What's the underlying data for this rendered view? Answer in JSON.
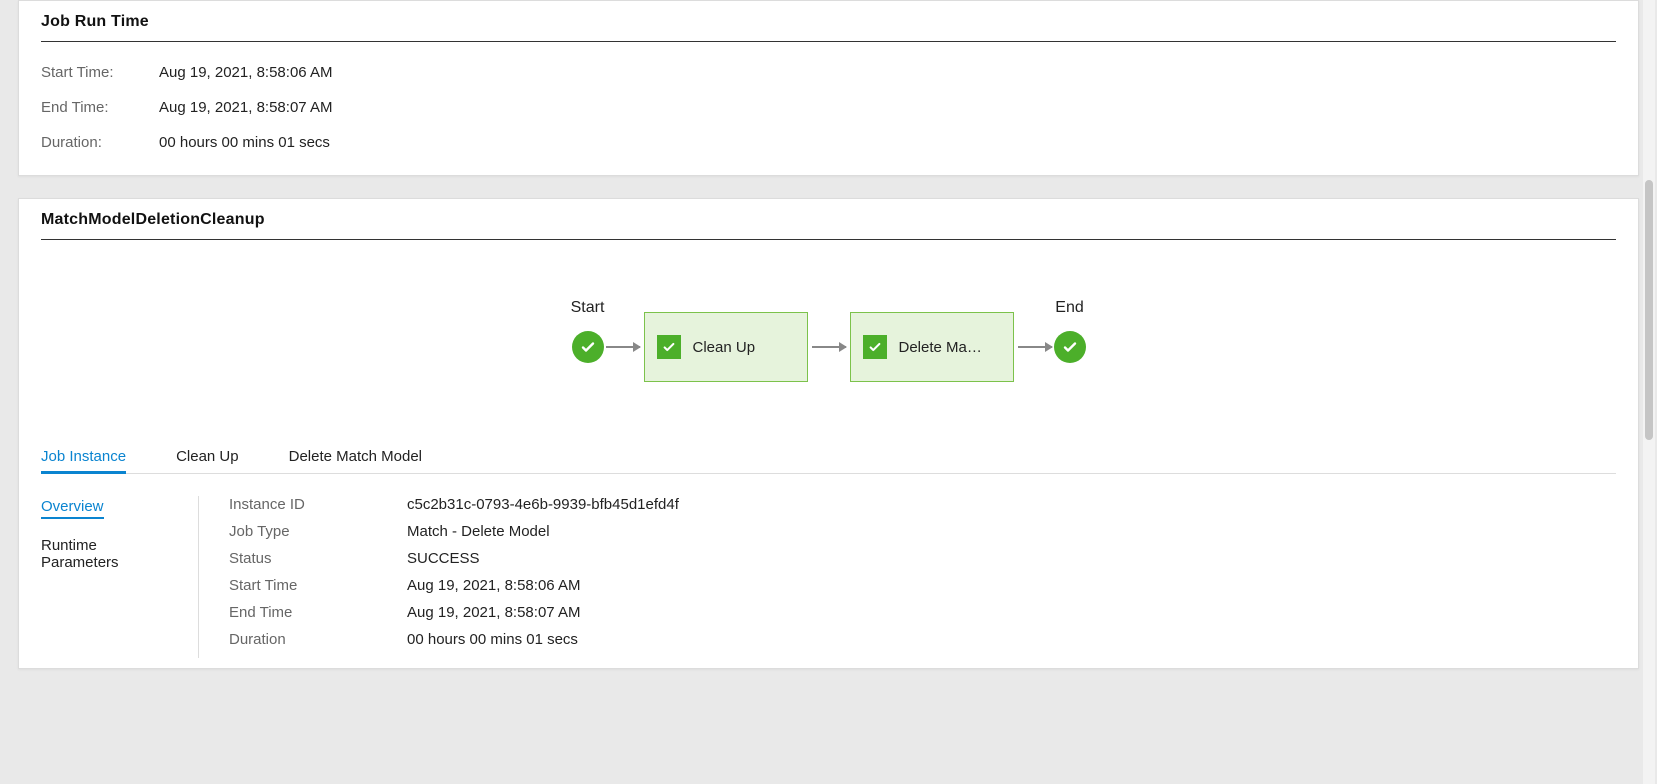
{
  "jobRunTime": {
    "title": "Job Run Time",
    "startTimeLabel": "Start Time:",
    "startTimeValue": "Aug 19, 2021, 8:58:06 AM",
    "endTimeLabel": "End Time:",
    "endTimeValue": "Aug 19, 2021, 8:58:07 AM",
    "durationLabel": "Duration:",
    "durationValue": "00 hours 00 mins 01 secs"
  },
  "workflow": {
    "title": "MatchModelDeletionCleanup",
    "startLabel": "Start",
    "endLabel": "End",
    "steps": [
      {
        "label": "Clean Up"
      },
      {
        "label": "Delete Ma…"
      }
    ]
  },
  "tabs": {
    "items": [
      {
        "label": "Job Instance",
        "active": true
      },
      {
        "label": "Clean Up",
        "active": false
      },
      {
        "label": "Delete Match Model",
        "active": false
      }
    ]
  },
  "sideNav": {
    "items": [
      {
        "label": "Overview",
        "active": true
      },
      {
        "label": "Runtime Parameters",
        "active": false
      }
    ]
  },
  "details": {
    "rows": [
      {
        "label": "Instance ID",
        "value": "c5c2b31c-0793-4e6b-9939-bfb45d1efd4f"
      },
      {
        "label": "Job Type",
        "value": "Match - Delete Model"
      },
      {
        "label": "Status",
        "value": "SUCCESS"
      },
      {
        "label": "Start Time",
        "value": "Aug 19, 2021, 8:58:06 AM"
      },
      {
        "label": "End Time",
        "value": "Aug 19, 2021, 8:58:07 AM"
      },
      {
        "label": "Duration",
        "value": "00 hours 00 mins 01 secs"
      }
    ]
  }
}
